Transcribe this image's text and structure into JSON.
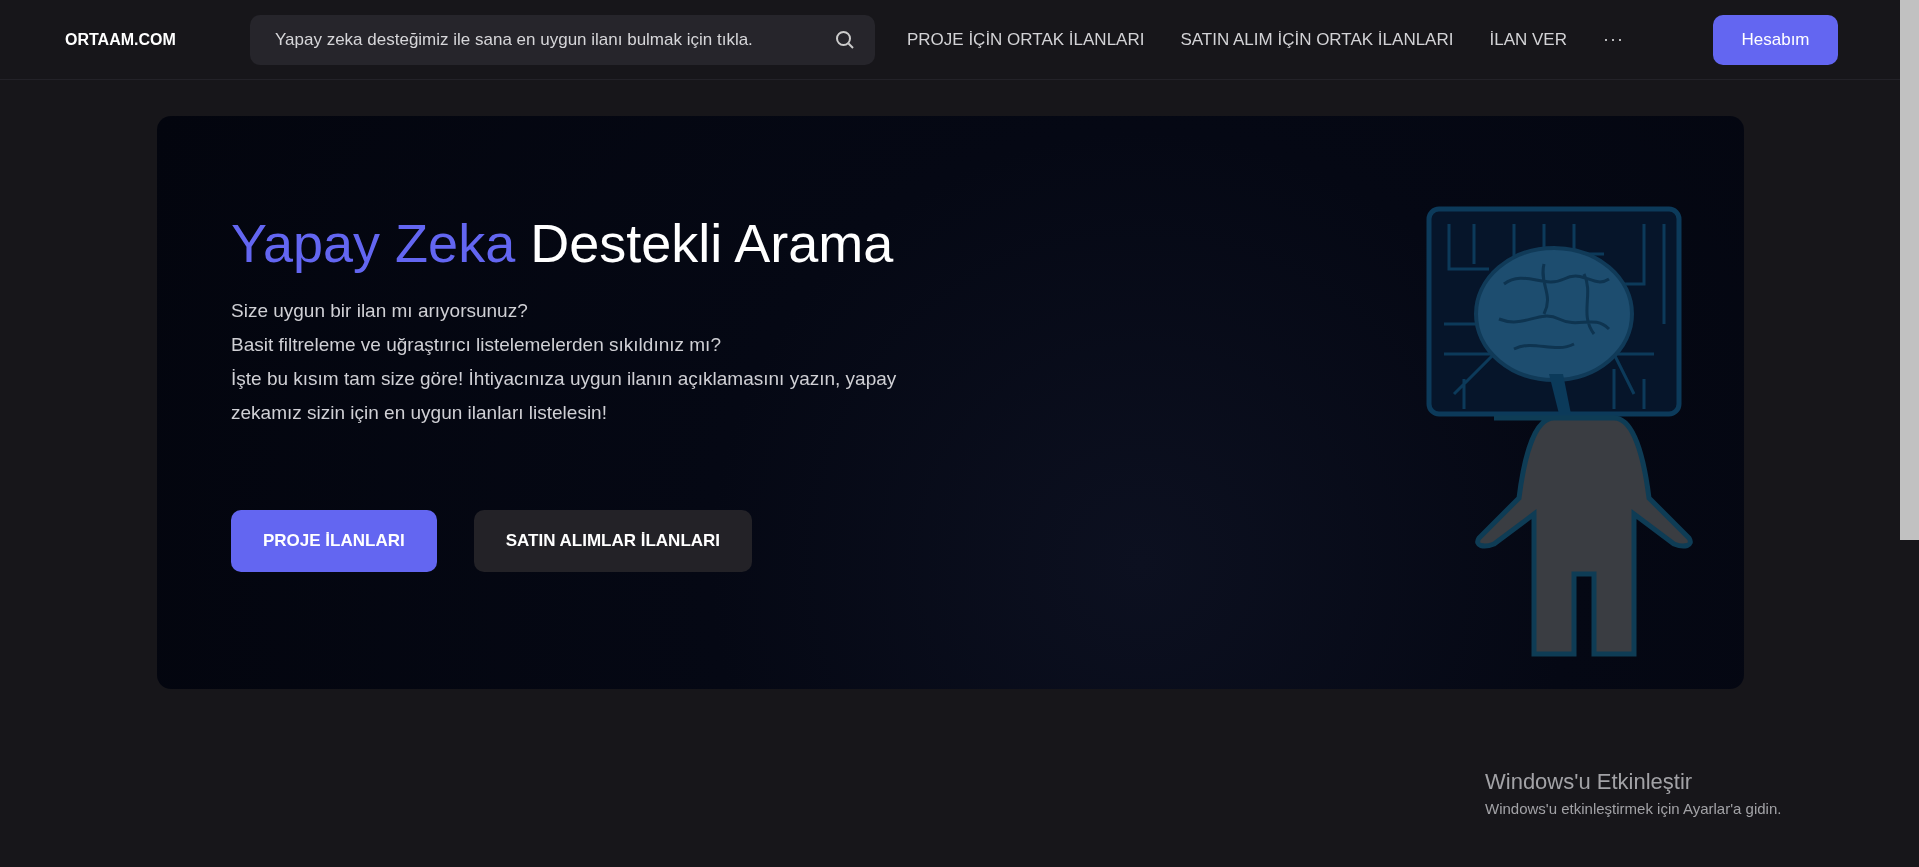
{
  "navbar": {
    "logo": "ORTAAM.COM",
    "search": {
      "placeholder": "Yapay zeka desteğimiz ile sana en uygun ilanı bulmak için tıkla."
    },
    "links": [
      "PROJE İÇİN ORTAK İLANLARI",
      "SATIN ALIM İÇİN ORTAK İLANLARI",
      "İLAN VER"
    ],
    "more": "···",
    "account_button": "Hesabım"
  },
  "hero": {
    "title_highlight": "Yapay Zeka",
    "title_rest": "Destekli Arama",
    "paragraphs": [
      "Size uygun bir ilan mı arıyorsunuz?",
      "Basit filtreleme ve uğraştırıcı listelemelerden sıkıldınız mı?",
      "İşte bu kısım tam size göre! İhtiyacınıza uygun ilanın açıklamasını yazın, yapay zekamız sizin için en uygun ilanları listelesin!"
    ],
    "buttons": [
      {
        "label": "PROJE İLANLARI",
        "kind": "primary"
      },
      {
        "label": "SATIN ALIMLAR İLANLARI",
        "kind": "dark"
      }
    ]
  },
  "os_watermark": {
    "title": "Windows'u Etkinleştir",
    "subtitle": "Windows'u etkinleştirmek için Ayarlar'a gidin."
  }
}
